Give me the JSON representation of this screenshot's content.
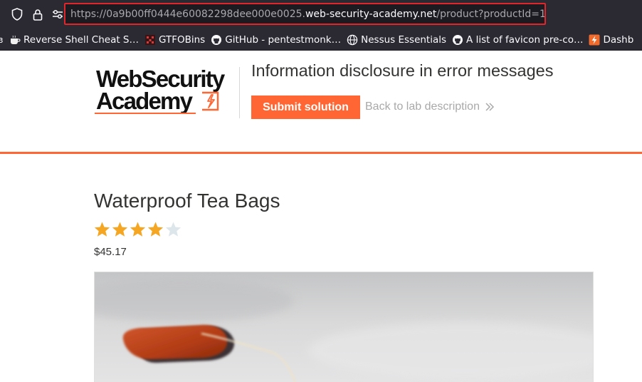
{
  "browser": {
    "url": {
      "scheme": "https://",
      "subdomain": "0a9b00ff0444e60082298dee000e0025.",
      "host": "web-security-academy.net",
      "path": "/product?productId=1"
    },
    "toolbar_icons": [
      "shield-icon",
      "lock-icon",
      "permissions-icon"
    ],
    "bookmarks": [
      {
        "label": "Reverse Shell Cheat S…",
        "icon": "cup-icon"
      },
      {
        "label": "GTFOBins",
        "icon": "gtfobins-icon"
      },
      {
        "label": "GitHub - pentestmonk…",
        "icon": "github-icon"
      },
      {
        "label": "Nessus Essentials",
        "icon": "globe-icon"
      },
      {
        "label": "A list of favicon pre-co…",
        "icon": "github-icon"
      },
      {
        "label": "Dashb",
        "icon": "bolt-icon"
      }
    ]
  },
  "lab_header": {
    "logo_line1": "WebSecurity",
    "logo_line2": "Academy",
    "title": "Information disclosure in error messages",
    "submit_label": "Submit solution",
    "back_label": "Back to lab description"
  },
  "product": {
    "name": "Waterproof Tea Bags",
    "rating": 4,
    "rating_max": 5,
    "price": "$45.17"
  },
  "colors": {
    "accent": "#ff6633",
    "star_filled": "#f5a623",
    "star_empty": "#dde6ea",
    "highlight_box": "#e0262b"
  }
}
